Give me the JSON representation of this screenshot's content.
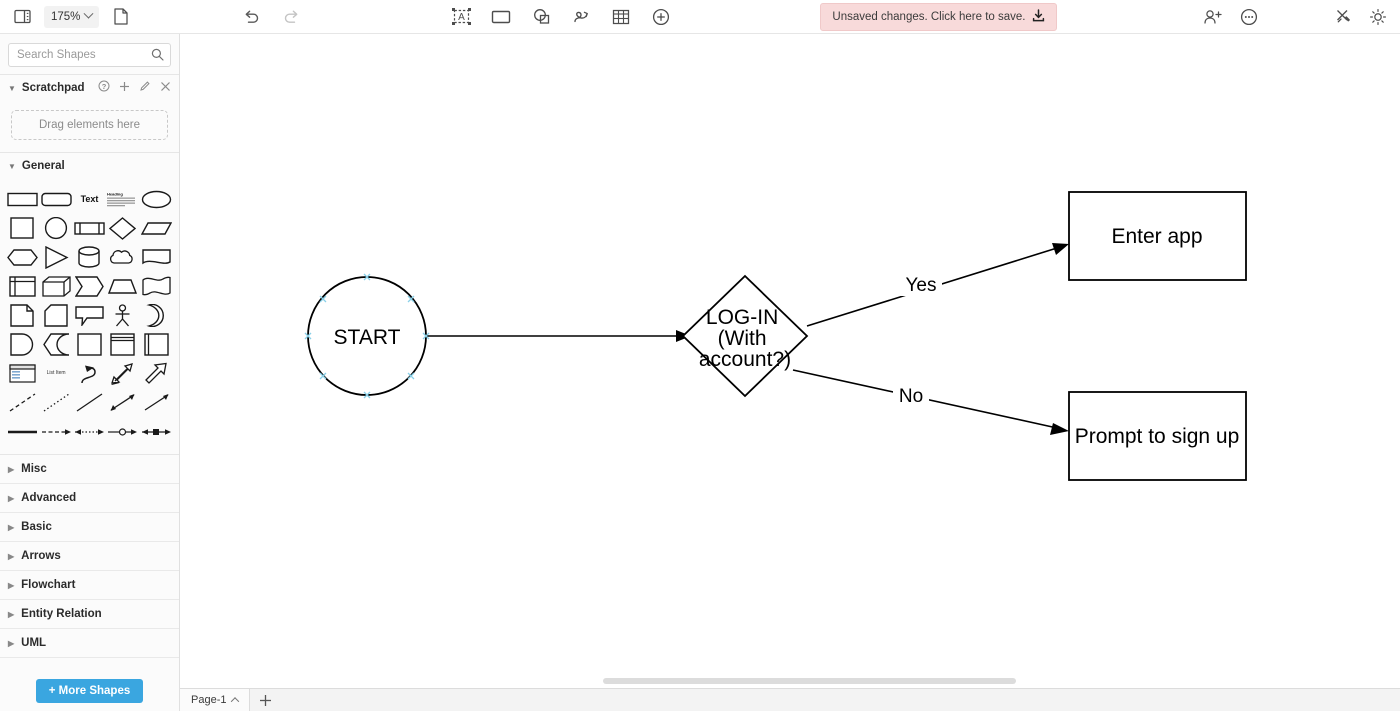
{
  "toolbar": {
    "sidebar_toggle_icon": "panel-toggle-icon",
    "zoom_level": "175%",
    "page_icon": "file-page-icon",
    "undo_icon": "undo-icon",
    "redo_icon": "redo-icon",
    "tools": [
      {
        "name": "text-tool",
        "icon": "text-box-icon"
      },
      {
        "name": "rectangle-tool",
        "icon": "rectangle-icon"
      },
      {
        "name": "shape-tool",
        "icon": "shapes-icon"
      },
      {
        "name": "freehand-tool",
        "icon": "scribble-icon"
      },
      {
        "name": "table-tool",
        "icon": "table-grid-icon"
      },
      {
        "name": "add-tool",
        "icon": "plus-circle-icon"
      }
    ],
    "save_banner": "Unsaved changes. Click here to save.",
    "save_banner_icon": "download-icon",
    "share_icon": "add-person-icon",
    "more_icon": "more-dots-circle-icon",
    "format_icon": "pen-ruler-icon",
    "theme_icon": "sun-brightness-icon"
  },
  "sidebar": {
    "search": {
      "placeholder": "Search Shapes",
      "value": "",
      "icon": "search-icon"
    },
    "scratchpad": {
      "title": "Scratchpad",
      "dropzone_label": "Drag elements here",
      "actions": [
        {
          "name": "scratchpad-help",
          "icon": "question-circle-icon"
        },
        {
          "name": "scratchpad-add",
          "icon": "plus-icon"
        },
        {
          "name": "scratchpad-edit",
          "icon": "pencil-icon"
        },
        {
          "name": "scratchpad-close",
          "icon": "close-icon"
        }
      ]
    },
    "general": {
      "title": "General",
      "shapes": [
        "rectangle",
        "rounded-rectangle",
        "text",
        "heading-textbox",
        "ellipse",
        "square",
        "circle",
        "process",
        "diamond",
        "parallelogram",
        "hexagon",
        "triangle",
        "cylinder",
        "cloud",
        "document",
        "internal-storage",
        "cube",
        "step",
        "trapezoid",
        "tape",
        "note",
        "card",
        "callout",
        "actor",
        "or-moon",
        "delay",
        "display",
        "container",
        "vertical-container",
        "horizontal-container",
        "list",
        "list-item",
        "curved-arrow",
        "double-arrow",
        "block-arrow",
        "dashed-line",
        "dotted-line",
        "line",
        "bidirectional-arrow",
        "directional-arrow",
        "thick-line",
        "dashed-connector",
        "dotted-connector",
        "link-connector",
        "node-connector"
      ],
      "shape_labels": {
        "text": "Text",
        "heading": "Heading"
      }
    },
    "categories": [
      "Misc",
      "Advanced",
      "Basic",
      "Arrows",
      "Flowchart",
      "Entity Relation",
      "UML"
    ],
    "more_shapes_button": "+ More Shapes"
  },
  "canvas": {
    "nodes": [
      {
        "id": "start",
        "type": "ellipse",
        "label": "START"
      },
      {
        "id": "login",
        "type": "diamond",
        "label": "LOG-IN (With account?)",
        "label_lines": [
          "LOG-IN",
          "(With",
          "account?)"
        ]
      },
      {
        "id": "enter",
        "type": "rectangle",
        "label": "Enter app"
      },
      {
        "id": "signup",
        "type": "rectangle",
        "label": "Prompt to sign up"
      }
    ],
    "edges": [
      {
        "from": "start",
        "to": "login",
        "label": ""
      },
      {
        "from": "login",
        "to": "enter",
        "label": "Yes"
      },
      {
        "from": "login",
        "to": "signup",
        "label": "No"
      }
    ],
    "selection_handle_color": "#8ad0e8",
    "stroke_color": "#000000"
  },
  "tabbar": {
    "page_name": "Page-1",
    "add_page_label": "+"
  }
}
